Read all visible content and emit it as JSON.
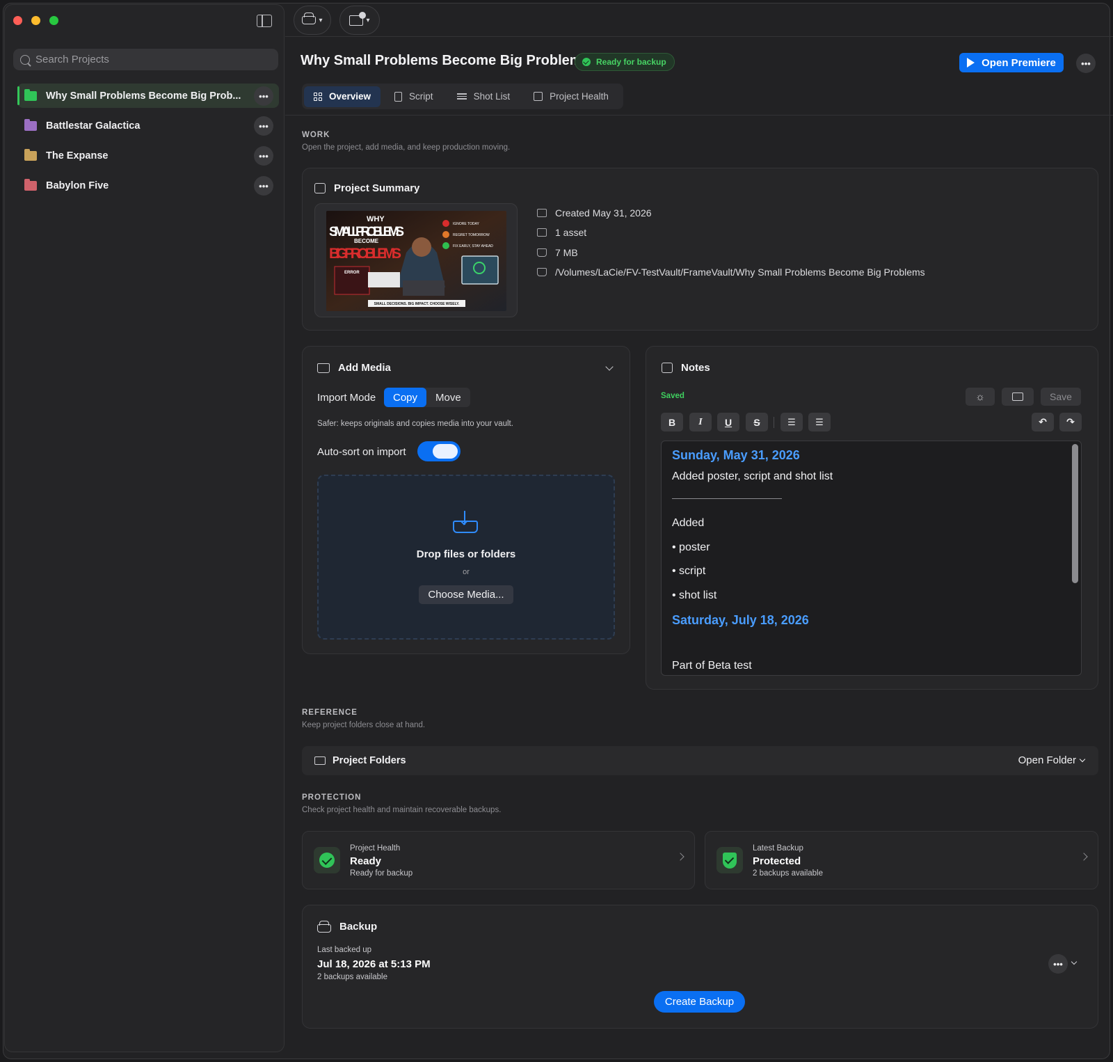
{
  "window": {
    "traffic_lights": [
      "#ff5f57",
      "#febc2e",
      "#28c840"
    ]
  },
  "sidebar": {
    "search_placeholder": "Search Projects",
    "projects": [
      {
        "label": "Why Small Problems Become Big Prob...",
        "folder_color": "#30c458",
        "active": true
      },
      {
        "label": "Battlestar Galactica",
        "folder_color": "#9b6fc3",
        "active": false
      },
      {
        "label": "The Expanse",
        "folder_color": "#c9a25a",
        "active": false
      },
      {
        "label": "Babylon Five",
        "folder_color": "#d0626b",
        "active": false
      }
    ]
  },
  "header": {
    "title": "Why Small Problems Become Big Problems",
    "status_badge": "Ready for backup",
    "open_button": "Open Premiere",
    "tabs": [
      {
        "label": "Overview",
        "icon": "grid-icon",
        "active": true
      },
      {
        "label": "Script",
        "icon": "document-icon",
        "active": false
      },
      {
        "label": "Shot List",
        "icon": "list-icon",
        "active": false
      },
      {
        "label": "Project Health",
        "icon": "health-icon",
        "active": false
      }
    ]
  },
  "work": {
    "label": "WORK",
    "subtitle": "Open the project, add media, and keep production moving."
  },
  "summary": {
    "title": "Project Summary",
    "poster": {
      "line1": "WHY",
      "line2": "SMALL PROBLEMS",
      "line3": "BECOME",
      "line4": "BIG PROBLEMS",
      "items": [
        "IGNORE TODAY",
        "REGRET TOMORROW",
        "FIX EARLY, STAY AHEAD"
      ],
      "error": "ERROR",
      "tagline": "SMALL DECISIONS. BIG IMPACT. CHOOSE WISELY."
    },
    "created": "Created May 31, 2026",
    "assets": "1 asset",
    "size": "7 MB",
    "path": "/Volumes/LaCie/FV-TestVault/FrameVault/Why Small Problems Become Big Problems"
  },
  "add_media": {
    "title": "Add Media",
    "import_mode_label": "Import Mode",
    "mode_options": [
      "Copy",
      "Move"
    ],
    "selected_mode": "Copy",
    "mode_description": "Safer: keeps originals and copies media into your vault.",
    "auto_sort_label": "Auto-sort on import",
    "auto_sort_on": true,
    "drop_title": "Drop files or folders",
    "drop_or": "or",
    "choose_button": "Choose Media..."
  },
  "notes": {
    "title": "Notes",
    "status": "Saved",
    "save_label": "Save",
    "format_buttons": [
      "B",
      "I",
      "U",
      "S"
    ],
    "lines": [
      {
        "text": "Sunday, May 31, 2026",
        "kind": "date"
      },
      {
        "text": "Added poster, script and shot list",
        "kind": "text"
      },
      {
        "text": "Added",
        "kind": "text"
      },
      {
        "text": "• poster",
        "kind": "text"
      },
      {
        "text": "• script",
        "kind": "text"
      },
      {
        "text": "• shot list",
        "kind": "text"
      },
      {
        "text": "Saturday, July 18, 2026",
        "kind": "date"
      },
      {
        "text": "Part of Beta test",
        "kind": "text"
      }
    ]
  },
  "reference": {
    "label": "REFERENCE",
    "subtitle": "Keep project folders close at hand.",
    "folders_title": "Project Folders",
    "open_folder": "Open Folder"
  },
  "protection": {
    "label": "PROTECTION",
    "subtitle": "Check project health and maintain recoverable backups.",
    "health": {
      "label": "Project Health",
      "value": "Ready",
      "detail": "Ready for backup"
    },
    "backup": {
      "label": "Latest Backup",
      "value": "Protected",
      "detail": "2 backups available"
    }
  },
  "backup": {
    "title": "Backup",
    "last_label": "Last backed up",
    "last_value": "Jul 18, 2026 at 5:13 PM",
    "count": "2 backups available",
    "create_button": "Create Backup"
  },
  "colors": {
    "accent": "#0a6ff2",
    "success": "#30c458",
    "note_date": "#4a9dff"
  }
}
